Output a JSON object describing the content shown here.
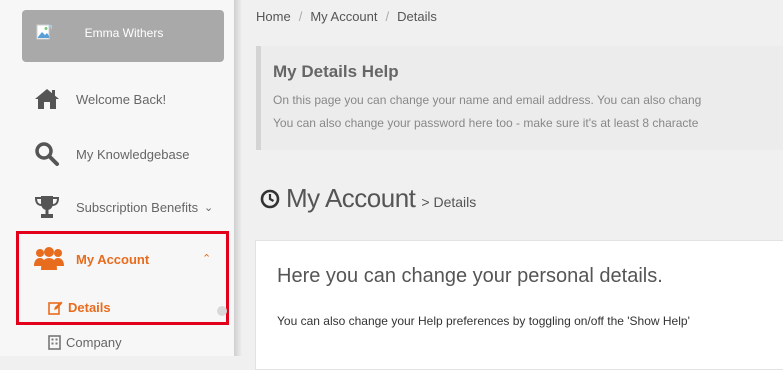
{
  "sidebar": {
    "user": {
      "name": "Emma Withers"
    },
    "items": [
      {
        "label": "Welcome Back!",
        "icon": "home-icon"
      },
      {
        "label": "My Knowledgebase",
        "icon": "search-icon"
      },
      {
        "label": "Subscription Benefits",
        "icon": "trophy-icon"
      }
    ],
    "account": {
      "label": "My Account",
      "icon": "users-icon",
      "subitems": [
        {
          "label": "Details",
          "icon": "edit-icon"
        },
        {
          "label": "Company",
          "icon": "building-icon"
        }
      ]
    }
  },
  "breadcrumb": {
    "home": "Home",
    "account": "My Account",
    "details": "Details"
  },
  "help": {
    "title": "My Details Help",
    "line1": "On this page you can change your name and email address. You can also chang",
    "line2": "You can also change your password here too - make sure it's at least 8 characte"
  },
  "heading": {
    "main": "My Account",
    "sub": "> Details"
  },
  "panel": {
    "title": "Here you can change your personal details.",
    "text": "You can also change your Help preferences by toggling on/off the 'Show Help' "
  },
  "colors": {
    "accent": "#e86c1e",
    "highlight": "#e3001b"
  }
}
